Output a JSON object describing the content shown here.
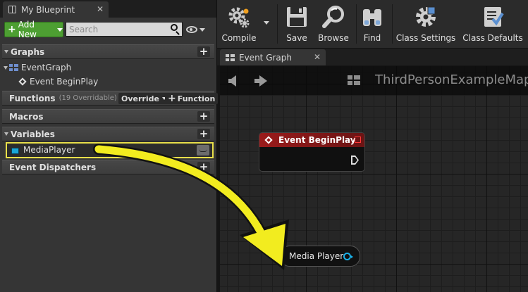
{
  "blueprint_panel": {
    "tab_title": "My Blueprint",
    "tab_close": "✕",
    "add_new_label": "Add New",
    "search_placeholder": "Search",
    "sections": {
      "graphs": {
        "title": "Graphs",
        "items": [
          {
            "label": "EventGraph",
            "icon": "graph-icon"
          },
          {
            "label": "Event BeginPlay",
            "icon": "event-diamond-icon"
          }
        ]
      },
      "functions": {
        "title": "Functions",
        "count_label": "(19 Overridable)",
        "override_label": "Override",
        "add_function_label": "Function"
      },
      "macros": {
        "title": "Macros"
      },
      "variables": {
        "title": "Variables",
        "items": [
          {
            "label": "MediaPlayer",
            "type_color": "#1aa7d8"
          }
        ]
      },
      "event_dispatchers": {
        "title": "Event Dispatchers"
      }
    }
  },
  "toolbar": {
    "buttons": [
      {
        "label": "Compile",
        "icon": "compile-gear-icon"
      },
      {
        "label": "Save",
        "icon": "floppy-disk-icon"
      },
      {
        "label": "Browse",
        "icon": "magnifying-glass-icon"
      },
      {
        "label": "Find",
        "icon": "binoculars-icon"
      },
      {
        "label": "Class Settings",
        "icon": "class-settings-gear-icon"
      },
      {
        "label": "Class Defaults",
        "icon": "clipboard-check-icon"
      }
    ]
  },
  "graph_editor": {
    "tab_title": "Event Graph",
    "tab_close": "✕",
    "breadcrumb": "ThirdPersonExampleMap",
    "nodes": {
      "event_begin_play": {
        "title": "Event BeginPlay",
        "header_color": "#9a1b1b"
      },
      "media_player_get": {
        "label": "Media Player",
        "pin_color": "#1ab0e8"
      }
    }
  },
  "colors": {
    "highlight": "#e8df4a",
    "annotation_arrow": "#f2ec1f",
    "add_new_green": "#4d9f32"
  }
}
